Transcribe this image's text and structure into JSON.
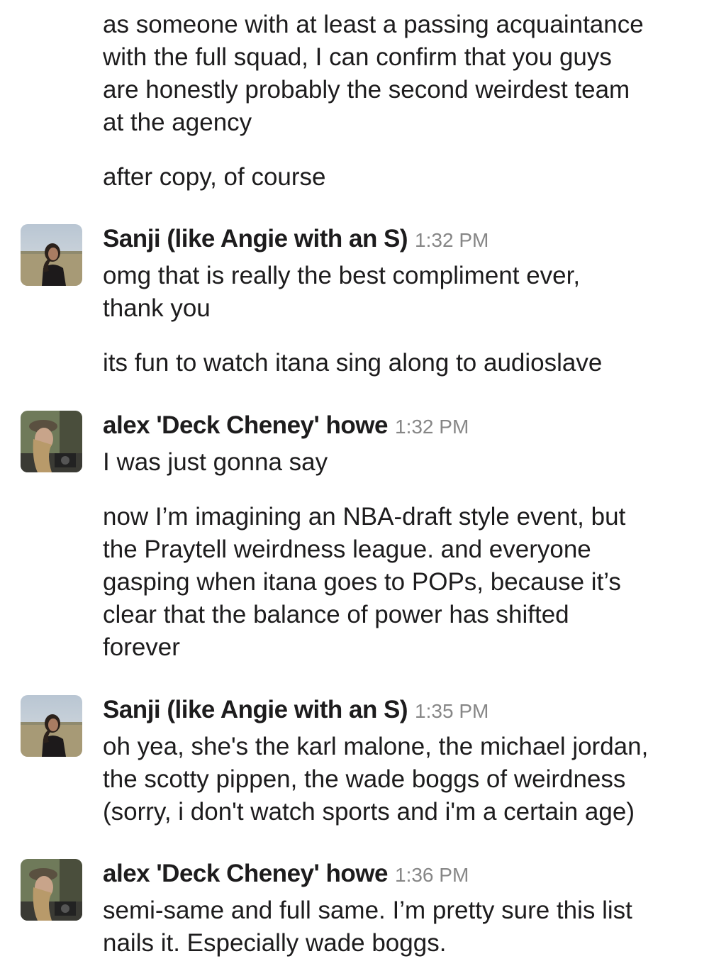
{
  "messages": [
    {
      "lines": [
        "as someone with at least a passing acquaintance",
        "with the full squad, I can confirm that you guys",
        "are honestly probably the second weirdest team",
        "at the agency"
      ]
    },
    {
      "lines": [
        "after copy, of course"
      ]
    },
    {
      "sender": "Sanji (like Angie with an S)",
      "time": "1:32 PM",
      "lines": [
        "omg that is really the best compliment ever,",
        "thank you"
      ]
    },
    {
      "lines": [
        "its fun to watch itana sing along to audioslave"
      ]
    },
    {
      "sender": "alex 'Deck Cheney' howe",
      "time": "1:32 PM",
      "lines": [
        "I was just gonna say"
      ]
    },
    {
      "lines": [
        "now I’m imagining an NBA-draft style event, but",
        "the Praytell weirdness league. and everyone",
        "gasping when itana goes to POPs, because it’s",
        "clear that the balance of power has shifted",
        "forever"
      ]
    },
    {
      "sender": "Sanji (like Angie with an S)",
      "time": "1:35 PM",
      "lines": [
        "oh yea, she's the karl malone, the michael jordan,",
        "the scotty pippen, the wade boggs of weirdness",
        "(sorry, i don't watch sports and i'm a certain age)"
      ]
    },
    {
      "sender": "alex 'Deck Cheney' howe",
      "time": "1:36 PM",
      "lines": [
        "semi-same and full same. I’m pretty sure this list",
        "nails it. Especially wade boggs."
      ]
    }
  ],
  "avatars": {
    "sanji": "avatar-sanji",
    "alex": "avatar-alex"
  }
}
